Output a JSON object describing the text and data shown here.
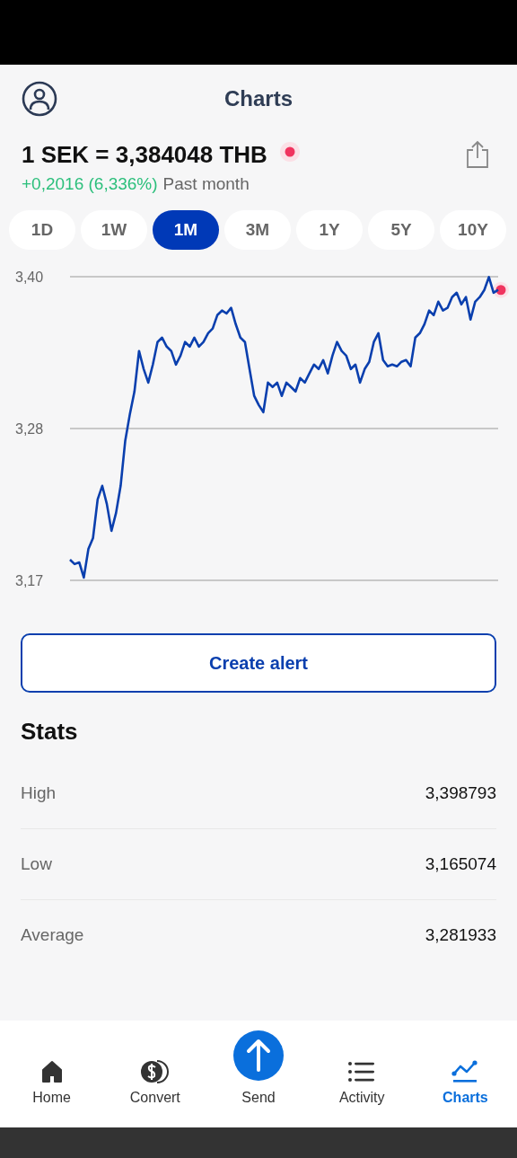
{
  "header": {
    "title": "Charts"
  },
  "rate": {
    "text": "1 SEK = 3,384048 THB",
    "change": "+0,2016 (6,336%)",
    "period": "Past month"
  },
  "periods": [
    {
      "label": "1D",
      "selected": false
    },
    {
      "label": "1W",
      "selected": false
    },
    {
      "label": "1M",
      "selected": true
    },
    {
      "label": "3M",
      "selected": false
    },
    {
      "label": "1Y",
      "selected": false
    },
    {
      "label": "5Y",
      "selected": false
    },
    {
      "label": "10Y",
      "selected": false
    }
  ],
  "chart_data": {
    "type": "line",
    "ylim": [
      3.165074,
      3.398793
    ],
    "yticks": [
      {
        "value": 3.398793,
        "label": "3,40"
      },
      {
        "value": 3.281933,
        "label": "3,28"
      },
      {
        "value": 3.165074,
        "label": "3,17"
      }
    ],
    "series": [
      {
        "color": "#0a3fae",
        "values": [
          3.181,
          3.1776,
          3.1789,
          3.1672,
          3.1893,
          3.1976,
          3.2274,
          3.2378,
          3.2239,
          3.2032,
          3.217,
          3.2378,
          3.2724,
          3.2931,
          3.3104,
          3.3416,
          3.3277,
          3.3173,
          3.3312,
          3.3485,
          3.3519,
          3.345,
          3.3416,
          3.3312,
          3.3381,
          3.3485,
          3.345,
          3.3519,
          3.345,
          3.3485,
          3.3554,
          3.3589,
          3.3692,
          3.3727,
          3.3706,
          3.3748,
          3.3623,
          3.3519,
          3.3485,
          3.3277,
          3.307,
          3.3,
          3.2945,
          3.3173,
          3.3139,
          3.3173,
          3.307,
          3.3173,
          3.3139,
          3.3104,
          3.3208,
          3.3173,
          3.3243,
          3.3312,
          3.3277,
          3.3346,
          3.3243,
          3.3381,
          3.3485,
          3.3416,
          3.3381,
          3.3277,
          3.3312,
          3.3173,
          3.3277,
          3.3333,
          3.3485,
          3.3554,
          3.3346,
          3.3298,
          3.3312,
          3.3298,
          3.3333,
          3.3346,
          3.3298,
          3.3519,
          3.3554,
          3.3623,
          3.3727,
          3.3692,
          3.3796,
          3.3727,
          3.3748,
          3.3831,
          3.3865,
          3.3775,
          3.3831,
          3.3658,
          3.3796,
          3.3831,
          3.3886,
          3.3985,
          3.3865,
          3.3886
        ]
      }
    ]
  },
  "alert_button": "Create alert",
  "stats": {
    "title": "Stats",
    "rows": [
      {
        "label": "High",
        "value": "3,398793"
      },
      {
        "label": "Low",
        "value": "3,165074"
      },
      {
        "label": "Average",
        "value": "3,281933"
      }
    ]
  },
  "nav": [
    {
      "kind": "home",
      "label": "Home",
      "selected": false
    },
    {
      "kind": "convert",
      "label": "Convert",
      "selected": false
    },
    {
      "kind": "send",
      "label": "Send",
      "selected": false
    },
    {
      "kind": "activity",
      "label": "Activity",
      "selected": false
    },
    {
      "kind": "charts",
      "label": "Charts",
      "selected": true
    }
  ]
}
